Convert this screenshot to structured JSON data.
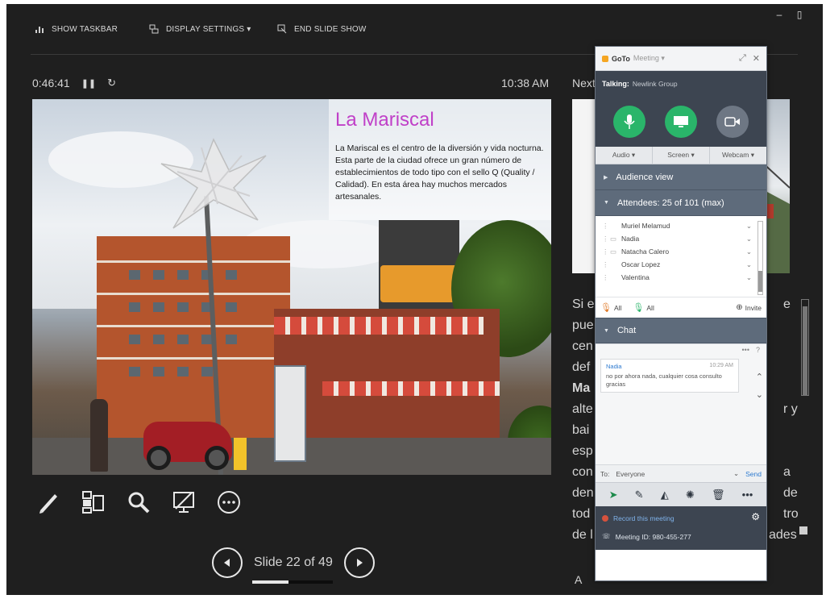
{
  "toolbar": {
    "show_taskbar": "SHOW TASKBAR",
    "display_settings": "DISPLAY SETTINGS ▾",
    "end_slide_show": "END SLIDE SHOW",
    "minimize_icon": "minimize-icon",
    "restore_icon": "restore-icon"
  },
  "timer": {
    "elapsed": "0:46:41",
    "pause_icon": "pause-icon",
    "restart_icon": "restart-icon"
  },
  "clock": "10:38 AM",
  "next_label": "Next",
  "slide": {
    "title": "La Mariscal",
    "body": "La Mariscal es el centro de la diversión y vida nocturna. Esta parte de la ciudad ofrece un gran número de establecimientos de todo tipo con el sello Q (Quality / Calidad). En esta área hay muchos mercados artesanales.",
    "title_color": "#c040c8"
  },
  "tools": [
    {
      "name": "pen-tool-icon"
    },
    {
      "name": "see-all-slides-icon"
    },
    {
      "name": "zoom-icon"
    },
    {
      "name": "black-screen-icon"
    },
    {
      "name": "more-options-icon"
    }
  ],
  "nav": {
    "slide_count": "Slide 22 of 49",
    "progress": 0.449
  },
  "notes": {
    "lines": [
      "Si e",
      "pue",
      "cen",
      "def",
      "Ma",
      "alte",
      "bai",
      "esp",
      "con",
      "den",
      "tod",
      "de l"
    ],
    "right_fragments": [
      "e",
      "r y",
      "a",
      "de",
      "tro",
      "ades"
    ],
    "font_increase": "A",
    "font_decrease": "A"
  },
  "gtm": {
    "brand": "GoTo",
    "brand_sub": "Meeting ▾",
    "talking_label": "Talking:",
    "talking_name": "Newlink Group",
    "audio": "Audio ▾",
    "screen": "Screen ▾",
    "webcam": "Webcam ▾",
    "audience_view": "Audience view",
    "attendees": "Attendees: 25 of 101 (max)",
    "attendee_list": [
      "Muriel Melamud",
      "Nadia",
      "Natacha Calero",
      "Oscar Lopez",
      "Valentina"
    ],
    "all_mute": "All",
    "all_unmute": "All",
    "invite": "Invite",
    "chat_label": "Chat",
    "message": {
      "name": "Nadia",
      "time": "10:29 AM",
      "text": "no por ahora nada, cualquier cosa consulto gracias"
    },
    "to_label": "To:",
    "to_value": "Everyone",
    "send": "Send",
    "record": "Record this meeting",
    "meeting_id": "Meeting ID: 980-455-277"
  }
}
